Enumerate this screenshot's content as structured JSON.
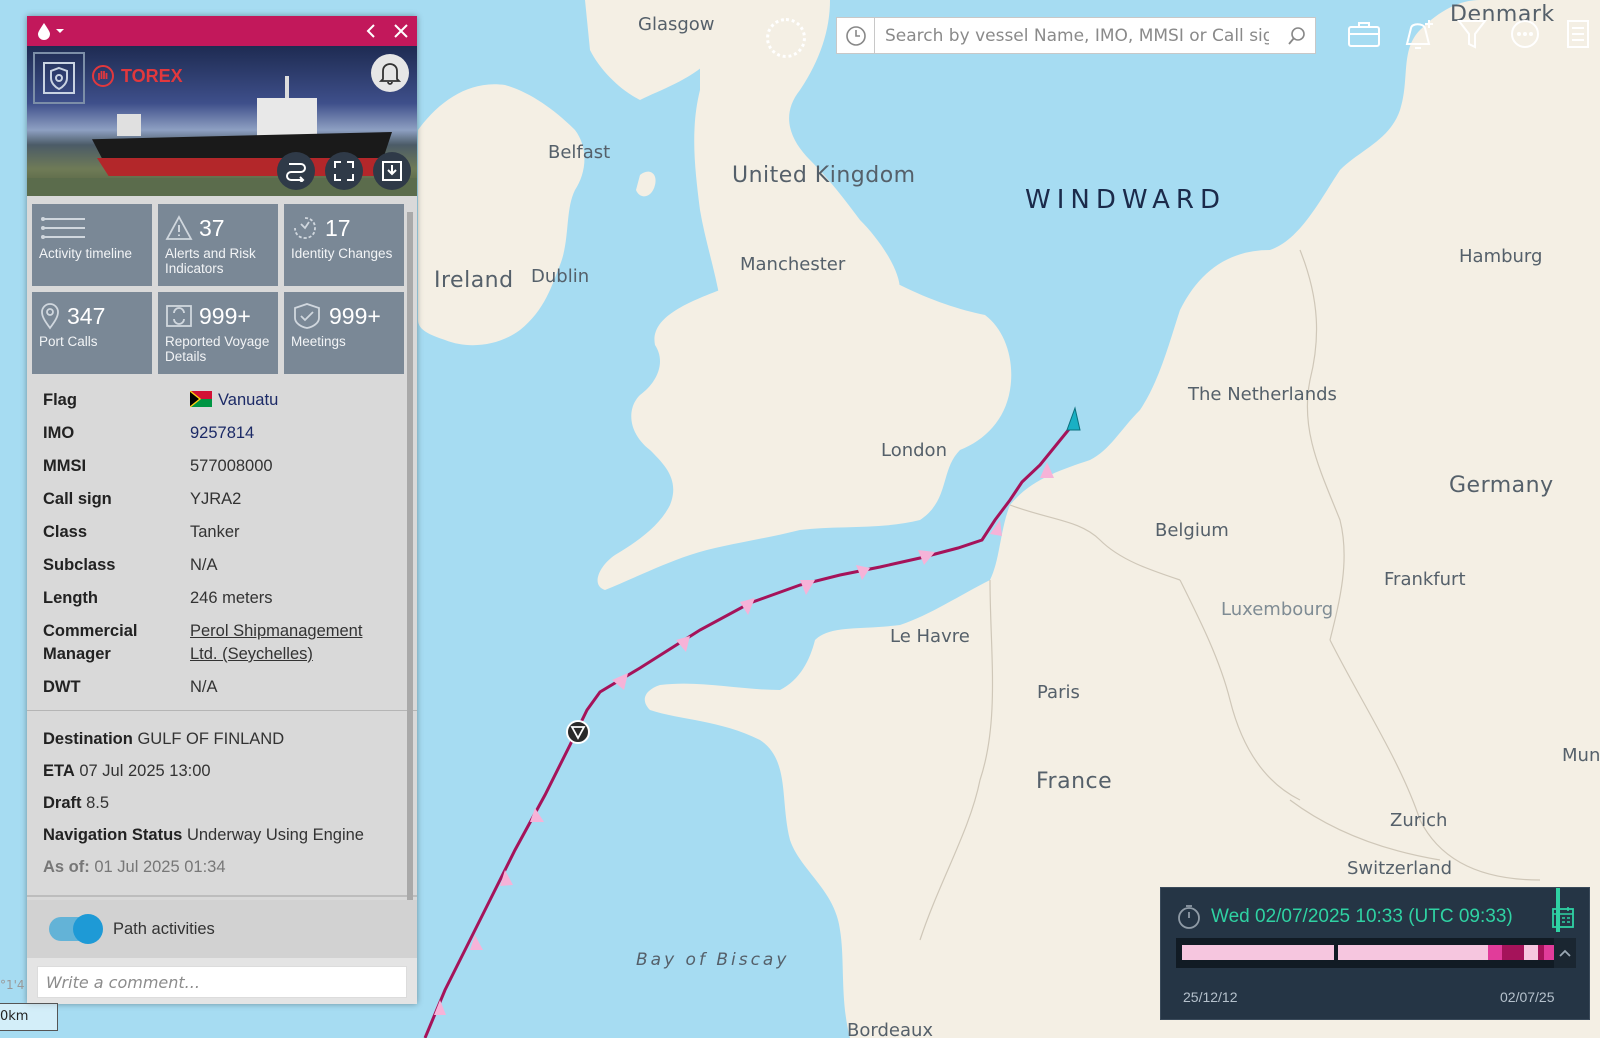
{
  "map": {
    "brand": "WINDWARD",
    "labels": {
      "glasgow": "Glasgow",
      "denmark": "Denmark",
      "belfast": "Belfast",
      "united_kingdom": "United Kingdom",
      "ireland": "Ireland",
      "dublin": "Dublin",
      "manchester": "Manchester",
      "hamburg": "Hamburg",
      "the_netherlands": "The Netherlands",
      "london": "London",
      "germany": "Germany",
      "belgium": "Belgium",
      "frankfurt": "Frankfurt",
      "luxembourg": "Luxembourg",
      "le_havre": "Le Havre",
      "paris": "Paris",
      "france": "France",
      "munich_partial": "Mun",
      "zurich": "Zurich",
      "switzerland": "Switzerland",
      "bay_of_biscay": "Bay of Biscay",
      "bordeaux": "Bordeaux"
    },
    "scale_label": "0km",
    "coord_fragment": "°1'4",
    "colors": {
      "sea": "#a6dcf2",
      "land": "#f4efe4",
      "track": "#a5135a",
      "track_arrow": "#f6b3d8",
      "vessel": "#19b0c4"
    }
  },
  "topbar": {
    "search_placeholder": "Search by vessel Name, IMO, MMSI or Call sign",
    "icons": [
      "clock-icon",
      "search-icon",
      "briefcase-icon",
      "add-alert-icon",
      "filter-icon",
      "more-icon",
      "list-icon"
    ]
  },
  "vessel": {
    "name": "TOREX",
    "tiles": [
      {
        "count": "",
        "label": "Activity timeline",
        "icon": "timeline-icon"
      },
      {
        "count": "37",
        "label": "Alerts and Risk Indicators",
        "icon": "warning-icon"
      },
      {
        "count": "17",
        "label": "Identity Changes",
        "icon": "identity-icon"
      },
      {
        "count": "347",
        "label": "Port Calls",
        "icon": "location-pin-icon"
      },
      {
        "count": "999+",
        "label": "Reported Voyage Details",
        "icon": "voyage-icon"
      },
      {
        "count": "999+",
        "label": "Meetings",
        "icon": "meetings-icon"
      }
    ],
    "details": {
      "flag": {
        "key": "Flag",
        "value": "Vanuatu"
      },
      "imo": {
        "key": "IMO",
        "value": "9257814"
      },
      "mmsi": {
        "key": "MMSI",
        "value": "577008000"
      },
      "call_sign": {
        "key": "Call sign",
        "value": "YJRA2"
      },
      "class": {
        "key": "Class",
        "value": "Tanker"
      },
      "subclass": {
        "key": "Subclass",
        "value": "N/A"
      },
      "length": {
        "key": "Length",
        "value": "246 meters"
      },
      "commercial_manager": {
        "key": "Commercial Manager",
        "value": "Perol Shipmanagement Ltd. (Seychelles)"
      },
      "dwt": {
        "key": "DWT",
        "value": "N/A"
      }
    },
    "voyage": {
      "destination": {
        "key": "Destination",
        "value": "GULF OF FINLAND"
      },
      "eta": {
        "key": "ETA",
        "value": "07 Jul 2025 13:00"
      },
      "draft": {
        "key": "Draft",
        "value": "8.5"
      },
      "nav_status": {
        "key": "Navigation Status",
        "value": "Underway Using Engine"
      },
      "as_of": {
        "key": "As of:",
        "value": "01 Jul 2025 01:34"
      }
    },
    "path_activities": {
      "label": "Path activities",
      "enabled": true
    },
    "comment_placeholder": "Write a comment..."
  },
  "timeline": {
    "date": "Wed 02/07/2025 10:33 (UTC 09:33)",
    "start": "25/12/12",
    "end": "02/07/25",
    "segment_colors": {
      "light": "#f6c6df",
      "mid": "#e13c9a",
      "dark": "#a5135a",
      "cursor": "#2fd2a3"
    }
  }
}
